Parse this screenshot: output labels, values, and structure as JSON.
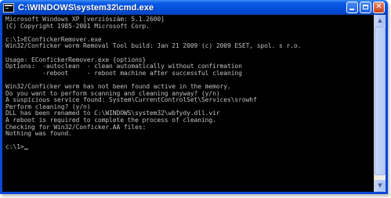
{
  "window": {
    "title": "C:\\WINDOWS\\system32\\cmd.exe",
    "icon": "cmd-icon",
    "buttons": {
      "minimize": "minimize-icon",
      "maximize": "maximize-icon",
      "close": "close-icon"
    }
  },
  "console": {
    "lines": [
      "Microsoft Windows XP [verziószám: 5.1.2600]",
      "(C) Copyright 1985-2001 Microsoft Corp.",
      "",
      "c:\\1>EConfickerRemover.exe",
      "Win32/Conficker worm Removal Tool build: Jan 21 2009 (c) 2009 ESET, spol. s r.o.",
      "",
      "Usage: EConfickerRemover.exe {options}",
      "Options:  -autoclean  - clean automatically without confirmation",
      "          -reboot     - reboot machine after successful cleaning",
      "",
      "Win32/Conficker worm has not been found active in the memory.",
      "Do you want to perform scanning and cleaning anyway? (y/n)",
      "A suspicious service found: System\\CurrentControlSet\\Services\\srowhf",
      "Perform cleaning? (y/n)",
      "DLL has been renamed to C:\\WINDOWS\\system32\\wbfydy.dll.vir",
      "A reboot is required to complete the process of cleaning.",
      "Checking for Win32/Conficker.AA files:",
      "Nothing was found.",
      "",
      "c:\\1>"
    ]
  },
  "colors": {
    "console_text": "#c0c0c0",
    "console_background": "#000000",
    "titlebar": "#0450d8"
  }
}
